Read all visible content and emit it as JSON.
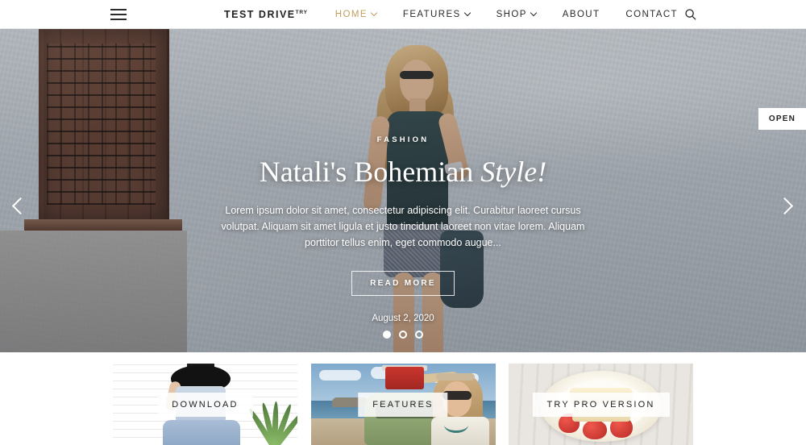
{
  "header": {
    "menu_icon": "hamburger-menu-icon",
    "logo_text": "TEST DRIVE",
    "logo_sup": "TRY",
    "search_icon": "search-icon",
    "nav": [
      {
        "label": "HOME",
        "has_caret": true,
        "active": true
      },
      {
        "label": "FEATURES",
        "has_caret": true,
        "active": false
      },
      {
        "label": "SHOP",
        "has_caret": true,
        "active": false
      },
      {
        "label": "ABOUT",
        "has_caret": false,
        "active": false
      },
      {
        "label": "CONTACT",
        "has_caret": false,
        "active": false
      }
    ]
  },
  "hero": {
    "category": "FASHION",
    "title_main": "Natali's Bohemian ",
    "title_em": "Style!",
    "description": "Lorem ipsum dolor sit amet, consectetur adipiscing elit. Curabitur laoreet cursus volutpat. Aliquam sit amet ligula et justo tincidunt laoreet non vitae lorem. Aliquam porttitor tellus enim, eget commodo augue...",
    "read_more_label": "READ MORE",
    "date": "August 2, 2020",
    "prev_icon": "chevron-left-icon",
    "next_icon": "chevron-right-icon",
    "slides": [
      {
        "active": true
      },
      {
        "active": false
      },
      {
        "active": false
      }
    ]
  },
  "open_tab": {
    "label": "OPEN"
  },
  "cards": [
    {
      "label": "DOWNLOAD"
    },
    {
      "label": "FEATURES"
    },
    {
      "label": "TRY PRO VERSION"
    }
  ],
  "colors": {
    "accent_gold": "#c0a062",
    "text_dark": "#2b2b2b",
    "header_bg": "#ffffff",
    "hero_overlay": "rgba(40,48,60,0.22)"
  }
}
